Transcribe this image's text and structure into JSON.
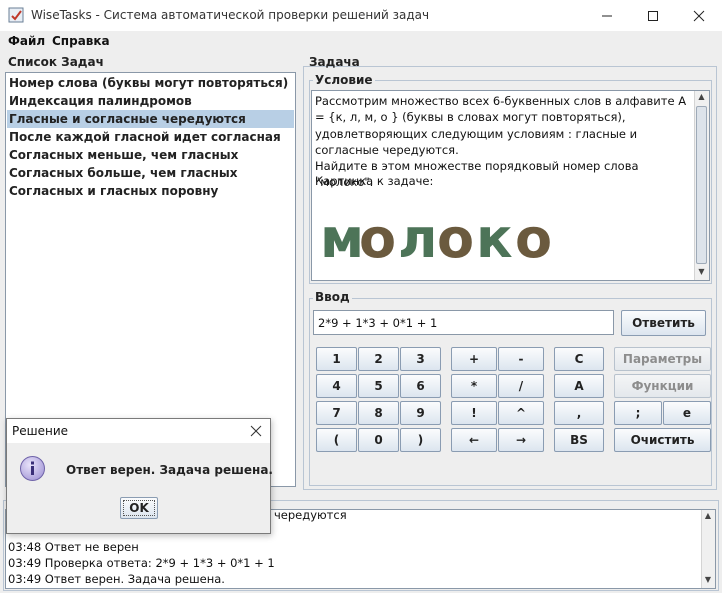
{
  "window": {
    "title": "WiseTasks - Система автоматической проверки решений задач",
    "minimize_icon": "minimize-icon",
    "maximize_icon": "maximize-icon",
    "close_icon": "close-icon"
  },
  "menu": {
    "file": "Файл",
    "help": "Справка"
  },
  "tasks": {
    "title": "Список Задач",
    "selected_index": 2,
    "items": [
      "Номер слова (буквы могут повторяться)",
      "Индексация палиндромов",
      "Гласные и согласные чередуются",
      "После каждой гласной идет согласная",
      "Согласных меньше, чем гласных",
      "Согласных больше, чем гласных",
      "Согласных и гласных поровну"
    ]
  },
  "task": {
    "title": "Задача",
    "condition_title": "Условие",
    "condition_text": "Рассмотрим множество всех 6-буквенных слов в алфавите А = {к, л, м, о } (буквы в словах могут повторяться), удовлетворяющих следующим условиям : гласные и согласные чередуются.\nНайдите в этом множестве порядковый номер слова \"молоко\".",
    "picture_label": "Картинка к задаче:",
    "picture_word": "молоко",
    "picture_colors": [
      "#4d7458",
      "#6b5a3e",
      "#4d7458",
      "#6b5a3e",
      "#4d7458",
      "#6b5a3e"
    ]
  },
  "input": {
    "title": "Ввод",
    "value": "2*9 + 1*3 + 0*1 + 1",
    "submit": "Ответить",
    "digits": [
      "1",
      "2",
      "3",
      "4",
      "5",
      "6",
      "7",
      "8",
      "9",
      "(",
      "0",
      ")"
    ],
    "ops": [
      "+",
      "-",
      "*",
      "/",
      "!",
      "^",
      "←",
      "→"
    ],
    "vars": [
      "C",
      "A",
      ",",
      "BS"
    ],
    "params": "Параметры",
    "functions": "Функции",
    "semicolon": ";",
    "e": "e",
    "clear": "Очистить"
  },
  "log": {
    "lines": [
      "чередуются",
      "03:48 Ответ не верен",
      "03:49 Проверка ответа: 2*9 + 1*3 + 0*1 + 1",
      "03:49 Ответ верен. Задача решена."
    ]
  },
  "dialog": {
    "title": "Решение",
    "message": "Ответ верен. Задача решена.",
    "ok": "OK",
    "icon": "info-icon"
  }
}
